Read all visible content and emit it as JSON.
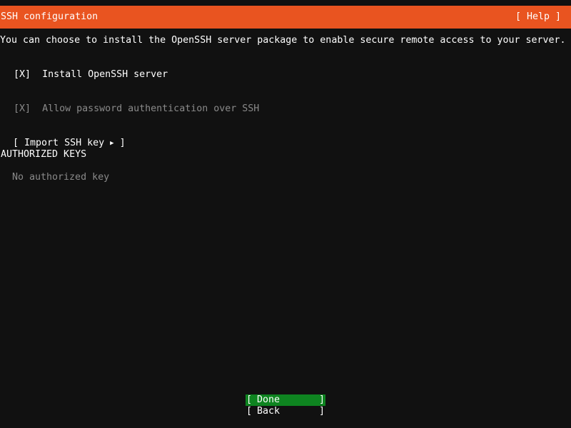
{
  "header": {
    "title": "SSH configuration",
    "help_label": "[ Help ]"
  },
  "colors": {
    "header_bg": "#e95420",
    "background": "#111111",
    "selected_button_bg": "#0e8420",
    "disabled_text": "#8a8a8a"
  },
  "description": "You can choose to install the OpenSSH server package to enable secure remote access to your server.",
  "install_openssh": {
    "checkbox": "[X]",
    "label": "Install OpenSSH server",
    "checked": true
  },
  "allow_password": {
    "checkbox": "[X]",
    "label": "Allow password authentication over SSH",
    "checked": true,
    "disabled": true
  },
  "import_key": {
    "open": "[ Import SSH key",
    "arrow": "▶",
    "close": "]",
    "arrow_icon": "play-triangle-icon"
  },
  "authorized_keys": {
    "heading": "AUTHORIZED KEYS",
    "empty_text": "No authorized key"
  },
  "buttons": {
    "done": {
      "open": "[",
      "label": "Done",
      "close": "]"
    },
    "back": {
      "open": "[",
      "label": "Back",
      "close": "]"
    }
  }
}
